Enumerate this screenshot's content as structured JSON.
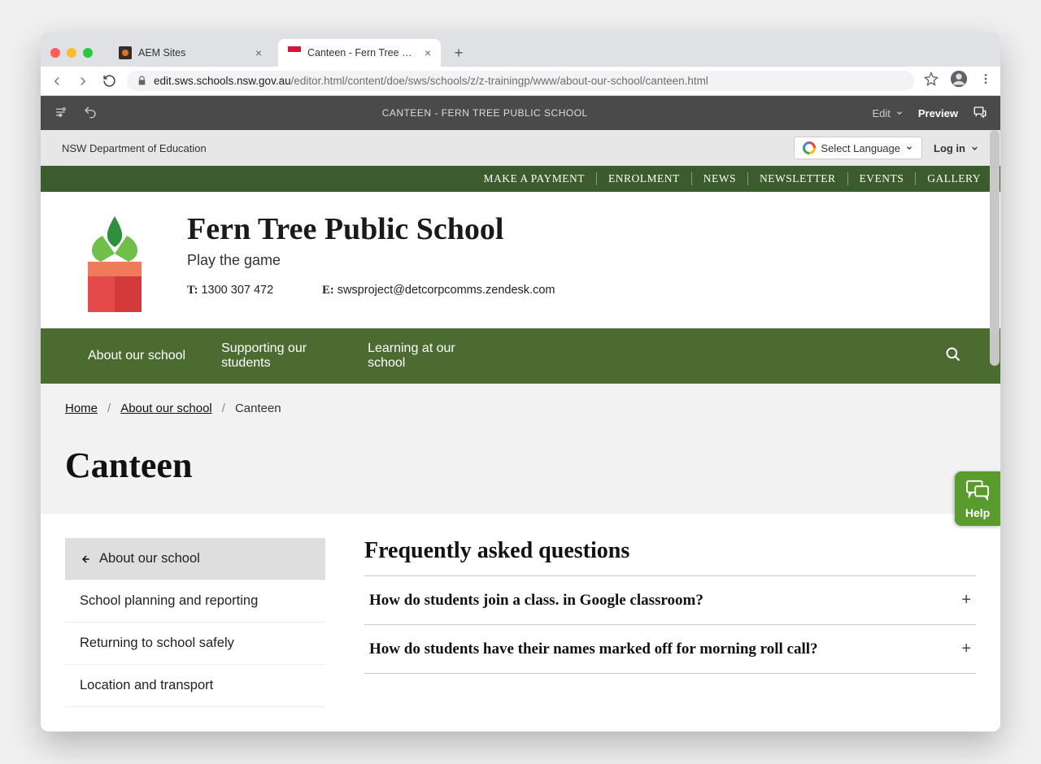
{
  "browser": {
    "tabs": [
      {
        "title": "AEM Sites",
        "active": false
      },
      {
        "title": "Canteen - Fern Tree Public Sch",
        "active": true
      }
    ],
    "url_host": "edit.sws.schools.nsw.gov.au",
    "url_path": "/editor.html/content/doe/sws/schools/z/z-trainingp/www/about-our-school/canteen.html"
  },
  "editor": {
    "title": "CANTEEN - FERN TREE PUBLIC SCHOOL",
    "mode_label": "Edit",
    "preview_label": "Preview"
  },
  "gov_bar": {
    "dept": "NSW Department of Education",
    "lang_label": "Select Language",
    "login_label": "Log in"
  },
  "util_nav": [
    "MAKE A PAYMENT",
    "ENROLMENT",
    "NEWS",
    "NEWSLETTER",
    "EVENTS",
    "GALLERY"
  ],
  "school": {
    "name": "Fern Tree Public School",
    "tagline": "Play the game",
    "phone_label": "T:",
    "phone": "1300 307 472",
    "email_label": "E:",
    "email": "swsproject@detcorpcomms.zendesk.com"
  },
  "main_nav": [
    "About our school",
    "Supporting our students",
    "Learning at our school"
  ],
  "breadcrumb": {
    "home": "Home",
    "parent": "About our school",
    "current": "Canteen"
  },
  "page_title": "Canteen",
  "side_nav": {
    "back": "About our school",
    "items": [
      "School planning and reporting",
      "Returning to school safely",
      "Location and transport"
    ]
  },
  "faq": {
    "heading": "Frequently asked questions",
    "items": [
      "How do students join a class. in Google classroom?",
      "How do students have their names marked off for morning roll call?"
    ]
  },
  "help_label": "Help"
}
